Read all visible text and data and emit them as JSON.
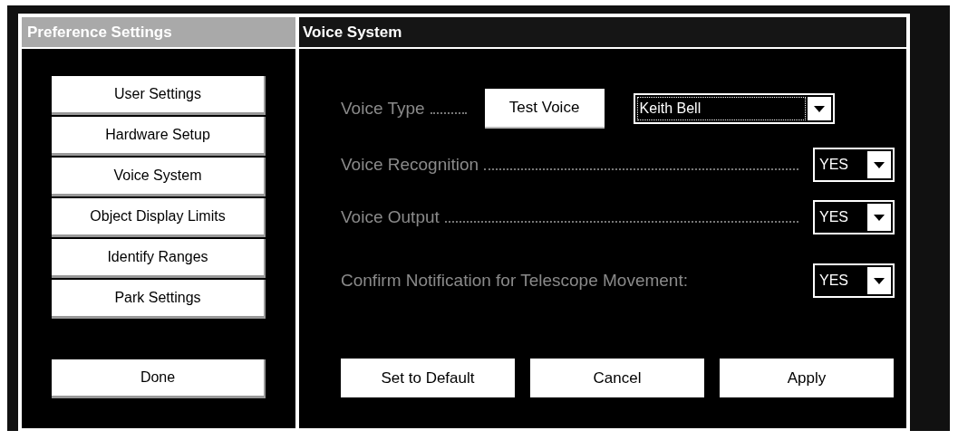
{
  "sidebar": {
    "title": "Preference Settings",
    "items": [
      {
        "label": "User Settings"
      },
      {
        "label": "Hardware Setup"
      },
      {
        "label": "Voice System"
      },
      {
        "label": "Object Display Limits"
      },
      {
        "label": "Identify Ranges"
      },
      {
        "label": "Park Settings"
      }
    ],
    "done_button": "Done"
  },
  "panel": {
    "title": "Voice System",
    "voice_type": {
      "label": "Voice Type",
      "test_button": "Test Voice",
      "value": "Keith Bell",
      "focused": true
    },
    "rows": [
      {
        "label": "Voice Recognition",
        "value": "YES",
        "focused": false,
        "leader": true
      },
      {
        "label": "Voice Output",
        "value": "YES",
        "focused": false,
        "leader": true
      },
      {
        "label": "Confirm Notification for Telescope Movement:",
        "value": "YES",
        "focused": false,
        "leader": false
      }
    ],
    "buttons": [
      "Set to Default",
      "Cancel",
      "Apply"
    ]
  }
}
